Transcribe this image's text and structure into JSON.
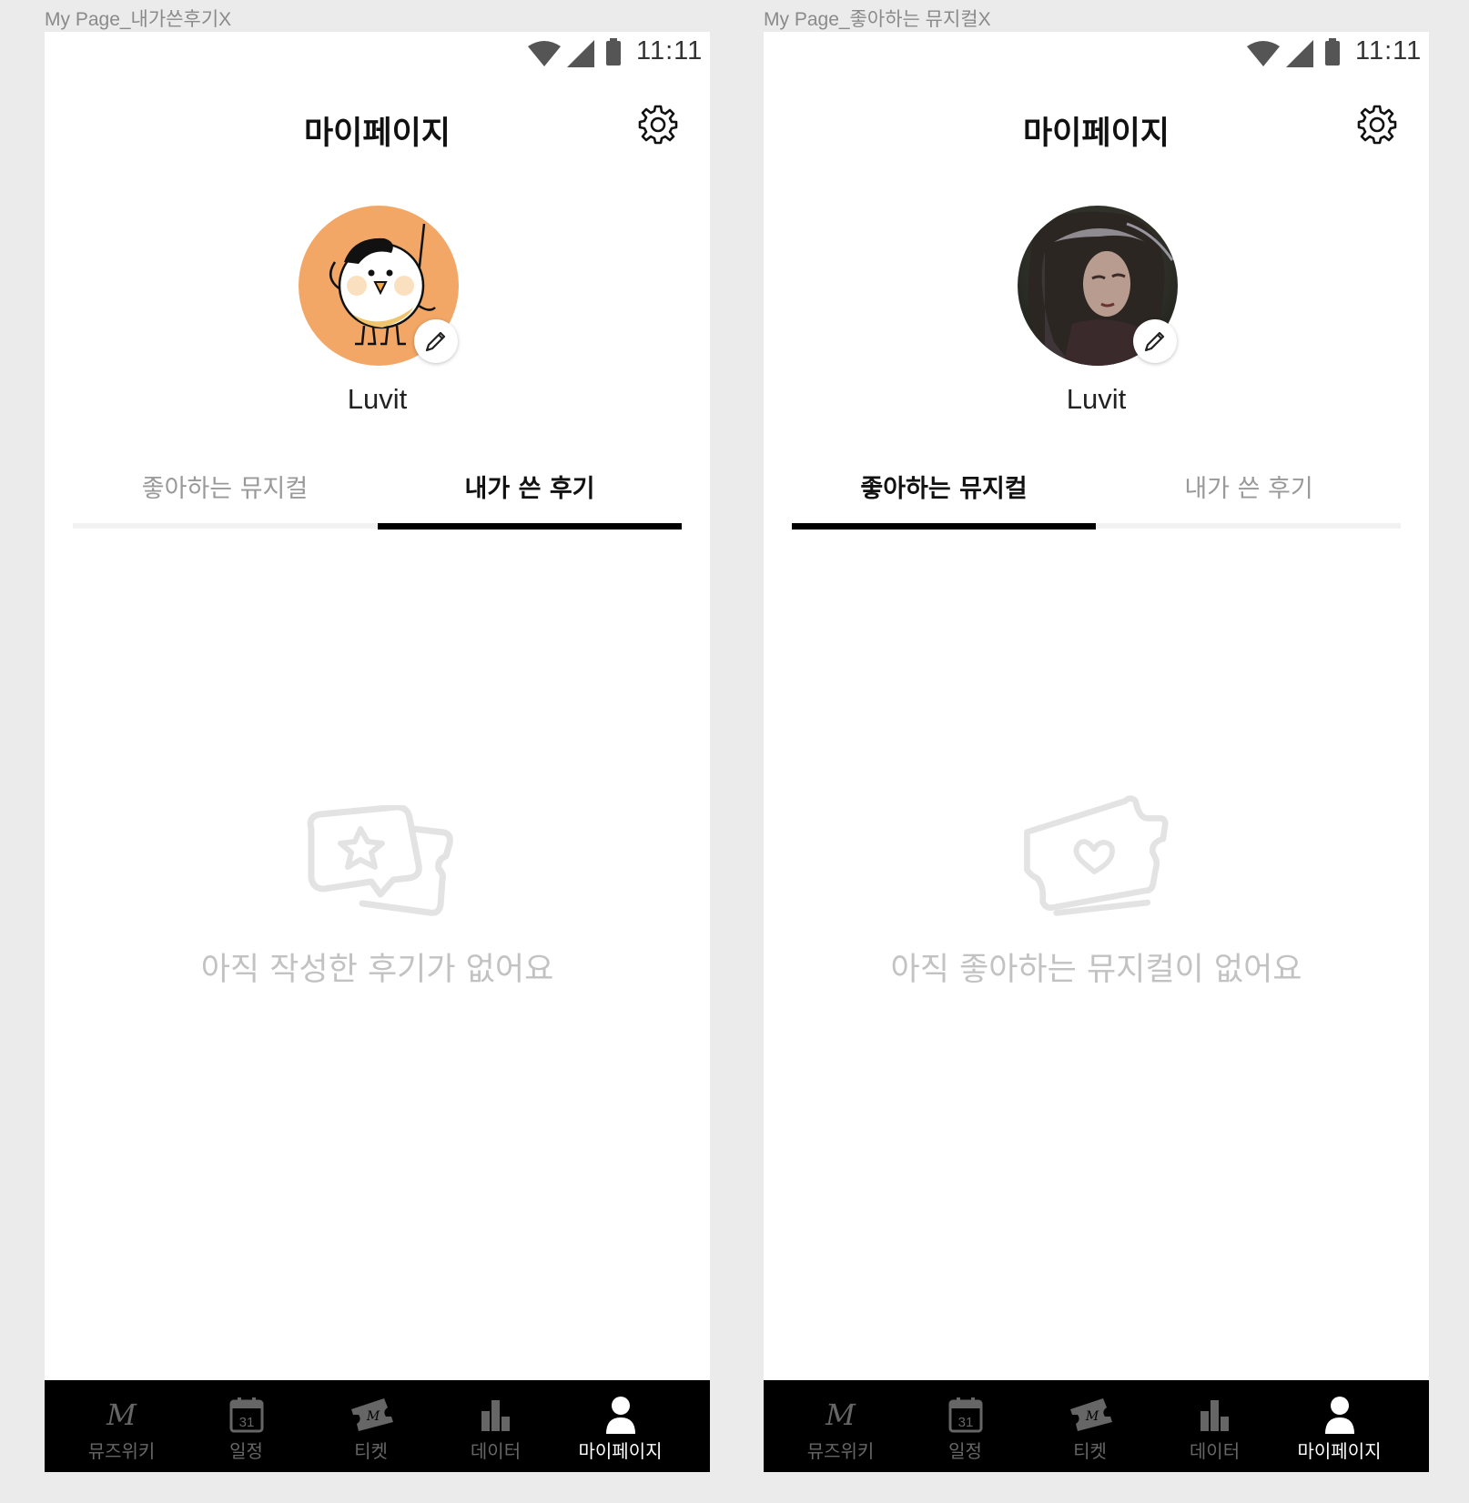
{
  "frames": [
    {
      "label": "My Page_내가쓴후기X",
      "status": {
        "time": "11:11"
      },
      "header": {
        "title": "마이페이지"
      },
      "profile": {
        "username": "Luvit",
        "avatar": "cartoon-egg-character"
      },
      "tabs": [
        {
          "label": "좋아하는 뮤지컬",
          "active": false
        },
        {
          "label": "내가 쓴 후기",
          "active": true
        }
      ],
      "empty_state": {
        "icon": "review-star-icon",
        "message": "아직 작성한 후기가 없어요"
      },
      "bottom_nav": [
        {
          "label": "뮤즈위키",
          "icon": "m-logo-icon",
          "active": false
        },
        {
          "label": "일정",
          "icon": "calendar-icon",
          "badge": "31",
          "active": false
        },
        {
          "label": "티켓",
          "icon": "ticket-icon",
          "active": false
        },
        {
          "label": "데이터",
          "icon": "bar-chart-icon",
          "active": false
        },
        {
          "label": "마이페이지",
          "icon": "person-icon",
          "active": true
        }
      ]
    },
    {
      "label": "My Page_좋아하는 뮤지컬X",
      "status": {
        "time": "11:11"
      },
      "header": {
        "title": "마이페이지"
      },
      "profile": {
        "username": "Luvit",
        "avatar": "photo-portrait"
      },
      "tabs": [
        {
          "label": "좋아하는 뮤지컬",
          "active": true
        },
        {
          "label": "내가 쓴 후기",
          "active": false
        }
      ],
      "empty_state": {
        "icon": "ticket-heart-icon",
        "message": "아직 좋아하는 뮤지컬이 없어요"
      },
      "bottom_nav": [
        {
          "label": "뮤즈위키",
          "icon": "m-logo-icon",
          "active": false
        },
        {
          "label": "일정",
          "icon": "calendar-icon",
          "badge": "31",
          "active": false
        },
        {
          "label": "티켓",
          "icon": "ticket-icon",
          "active": false
        },
        {
          "label": "데이터",
          "icon": "bar-chart-icon",
          "active": false
        },
        {
          "label": "마이페이지",
          "icon": "person-icon",
          "active": true
        }
      ]
    }
  ],
  "colors": {
    "canvas": "#ebebeb",
    "screen": "#ffffff",
    "accent": "#000000",
    "inactive_text": "#999999",
    "empty_text": "#c2c2c2",
    "avatar_orange": "#f2a766"
  }
}
